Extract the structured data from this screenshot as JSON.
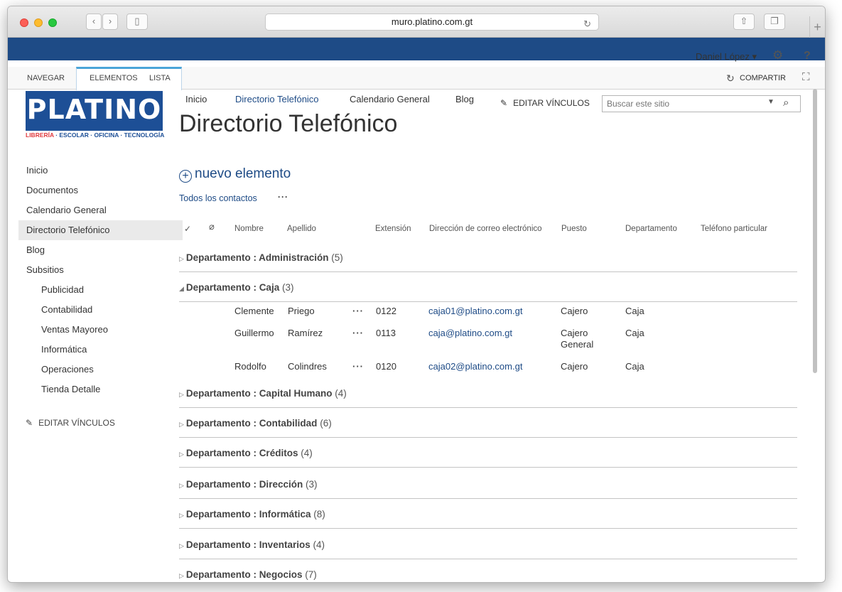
{
  "browser": {
    "url": "muro.platino.com.gt"
  },
  "suite": {
    "user_name": "Daniel López ▾"
  },
  "ribbon": {
    "tabs": [
      "NAVEGAR",
      "ELEMENTOS",
      "LISTA"
    ],
    "share_label": "COMPARTIR"
  },
  "logo": {
    "text": "PLATINO",
    "tagline_a": "LIBRERÍA",
    "tagline_b": " · ESCOLAR · OFICINA · TECNOLOGÍA"
  },
  "leftnav": {
    "items": [
      {
        "label": "Inicio"
      },
      {
        "label": "Documentos"
      },
      {
        "label": "Calendario General"
      },
      {
        "label": "Directorio Telefónico"
      },
      {
        "label": "Blog"
      },
      {
        "label": "Subsitios"
      },
      {
        "label": "Publicidad"
      },
      {
        "label": "Contabilidad"
      },
      {
        "label": "Ventas Mayoreo"
      },
      {
        "label": "Informática"
      },
      {
        "label": "Operaciones"
      },
      {
        "label": "Tienda Detalle"
      }
    ],
    "edit_links": "EDITAR VÍNCULOS"
  },
  "topnav": {
    "items": [
      "Inicio",
      "Directorio Telefónico",
      "Calendario General",
      "Blog"
    ],
    "edit_links": "EDITAR VÍNCULOS"
  },
  "search": {
    "placeholder": "Buscar este sitio"
  },
  "page": {
    "title": "Directorio Telefónico",
    "new_item": "nuevo elemento",
    "view_name": "Todos los contactos",
    "view_more": "···"
  },
  "columns": {
    "nombre": "Nombre",
    "apellido": "Apellido",
    "extension": "Extensión",
    "email": "Dirección de correo electrónico",
    "puesto": "Puesto",
    "departamento": "Departamento",
    "telefono": "Teléfono particular"
  },
  "groups": [
    {
      "label": "Departamento : Administración",
      "count": "(5)",
      "arrow": "▷"
    },
    {
      "label": "Departamento : Caja",
      "count": "(3)",
      "arrow": "◢"
    },
    {
      "label": "Departamento : Capital Humano",
      "count": "(4)",
      "arrow": "▷"
    },
    {
      "label": "Departamento : Contabilidad",
      "count": "(6)",
      "arrow": "▷"
    },
    {
      "label": "Departamento : Créditos",
      "count": "(4)",
      "arrow": "▷"
    },
    {
      "label": "Departamento : Dirección",
      "count": "(3)",
      "arrow": "▷"
    },
    {
      "label": "Departamento : Informática",
      "count": "(8)",
      "arrow": "▷"
    },
    {
      "label": "Departamento : Inventarios",
      "count": "(4)",
      "arrow": "▷"
    },
    {
      "label": "Departamento : Negocios",
      "count": "(7)",
      "arrow": "▷"
    }
  ],
  "rows": [
    {
      "nombre": "Clemente",
      "apellido": "Priego",
      "menu": "···",
      "extension": "0122",
      "email": "caja01@platino.com.gt",
      "puesto": "Cajero",
      "departamento": "Caja"
    },
    {
      "nombre": "Guillermo",
      "apellido": "Ramírez",
      "menu": "···",
      "extension": "0113",
      "email": "caja@platino.com.gt",
      "puesto": "Cajero General",
      "departamento": "Caja"
    },
    {
      "nombre": "Rodolfo",
      "apellido": "Colindres",
      "menu": "···",
      "extension": "0120",
      "email": "caja02@platino.com.gt",
      "puesto": "Cajero",
      "departamento": "Caja"
    }
  ]
}
